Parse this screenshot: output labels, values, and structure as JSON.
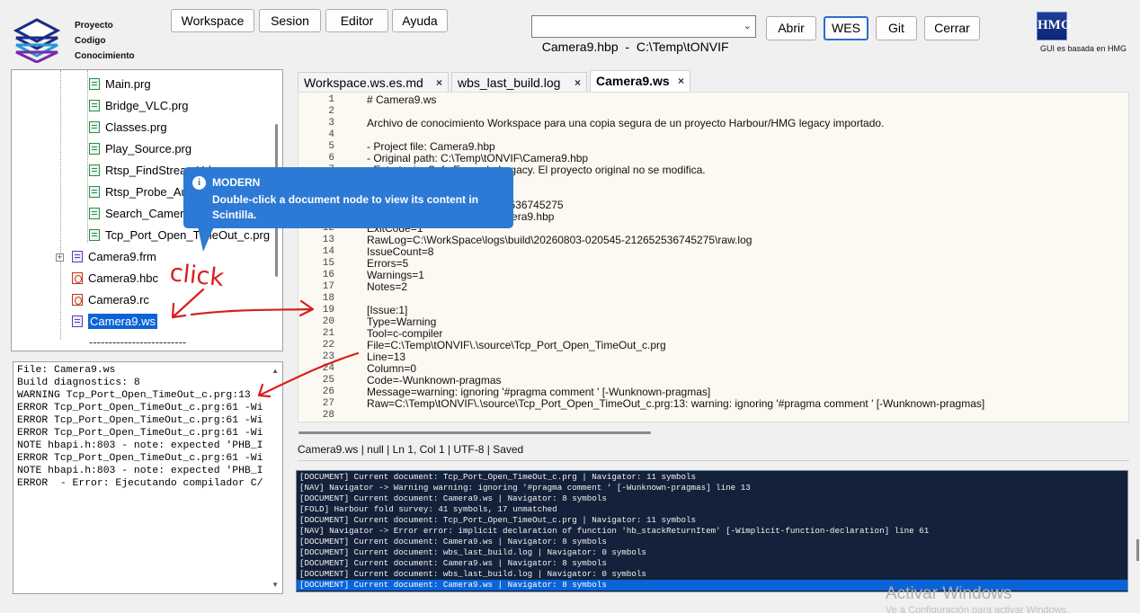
{
  "logo_text": [
    "Proyecto",
    "Codigo",
    "Conocimiento"
  ],
  "menu": [
    "Workspace",
    "Sesion",
    "Editor",
    "Ayuda"
  ],
  "project_select": {
    "value": "Camera9.hbp  -  C:\\Temp\\tONVIF"
  },
  "actions": [
    "Abrir",
    "WES",
    "Git",
    "Cerrar"
  ],
  "hmg": {
    "logo": "HMG",
    "text": "GUI es basada en HMG"
  },
  "tree": {
    "items": [
      {
        "label": "Main.prg",
        "icon": "prg-file-icon"
      },
      {
        "label": "Bridge_VLC.prg",
        "icon": "prg-file-icon"
      },
      {
        "label": "Classes.prg",
        "icon": "prg-file-icon"
      },
      {
        "label": "Play_Source.prg",
        "icon": "prg-file-icon"
      },
      {
        "label": "Rtsp_FindStreamUrl.prg",
        "icon": "prg-file-icon"
      },
      {
        "label": "Rtsp_Probe_Auth.prg",
        "icon": "prg-file-icon"
      },
      {
        "label": "Search_Camera.prg",
        "icon": "prg-file-icon"
      },
      {
        "label": "Tcp_Port_Open_TimeOut_c.prg",
        "icon": "prg-file-icon"
      },
      {
        "label": "Camera9.frm",
        "icon": "form-file-icon"
      },
      {
        "label": "Camera9.hbc",
        "icon": "resource-file-icon"
      },
      {
        "label": "Camera9.rc",
        "icon": "resource-file-icon"
      },
      {
        "label": "Camera9.ws",
        "icon": "workspace-file-icon"
      }
    ],
    "separator": "-------------------------"
  },
  "diagnostics": [
    "File: Camera9.ws",
    "Build diagnostics: 8",
    "WARNING Tcp_Port_Open_TimeOut_c.prg:13",
    "ERROR Tcp_Port_Open_TimeOut_c.prg:61 -Wi",
    "ERROR Tcp_Port_Open_TimeOut_c.prg:61 -Wi",
    "ERROR Tcp_Port_Open_TimeOut_c.prg:61 -Wi",
    "NOTE hbapi.h:803 - note: expected 'PHB_I",
    "ERROR Tcp_Port_Open_TimeOut_c.prg:61 -Wi",
    "NOTE hbapi.h:803 - note: expected 'PHB_I",
    "ERROR  - Error: Ejecutando compilador C/"
  ],
  "tabs": [
    {
      "label": "Workspace.ws.es.md",
      "close": "×"
    },
    {
      "label": "wbs_last_build.log",
      "close": "×"
    },
    {
      "label": "Camera9.ws",
      "close": "×"
    }
  ],
  "editor_lines": [
    {
      "n": "1",
      "t": "# Camera9.ws"
    },
    {
      "n": "2",
      "t": ""
    },
    {
      "n": "3",
      "t": "Archivo de conocimiento Workspace para una copia segura de un proyecto Harbour/HMG legacy importado."
    },
    {
      "n": "4",
      "t": ""
    },
    {
      "n": "5",
      "t": "- Project file: Camera9.hbp"
    },
    {
      "n": "6",
      "t": "- Original path: C:\\Temp\\tONVIF\\Camera9.hbp"
    },
    {
      "n": "7",
      "t": "- Estrategia: Safe Example Legacy. El proyecto original no se modifica."
    },
    {
      "n": "8",
      "t": ""
    },
    {
      "n": "9",
      "t": ""
    },
    {
      "n": "10",
      "t": "Id=20260803-020545-212652536745275"
    },
    {
      "n": "11",
      "t": "Project=C:\\Temp\\tONVIF\\Camera9.hbp"
    },
    {
      "n": "12",
      "t": "ExitCode=1"
    },
    {
      "n": "13",
      "t": "RawLog=C:\\WorkSpace\\logs\\build\\20260803-020545-212652536745275\\raw.log"
    },
    {
      "n": "14",
      "t": "IssueCount=8"
    },
    {
      "n": "15",
      "t": "Errors=5"
    },
    {
      "n": "16",
      "t": "Warnings=1"
    },
    {
      "n": "17",
      "t": "Notes=2"
    },
    {
      "n": "18",
      "t": ""
    },
    {
      "n": "19",
      "t": "[Issue:1]"
    },
    {
      "n": "20",
      "t": "Type=Warning"
    },
    {
      "n": "21",
      "t": "Tool=c-compiler"
    },
    {
      "n": "22",
      "t": "File=C:\\Temp\\tONVIF\\.\\source\\Tcp_Port_Open_TimeOut_c.prg"
    },
    {
      "n": "23",
      "t": "Line=13"
    },
    {
      "n": "24",
      "t": "Column=0"
    },
    {
      "n": "25",
      "t": "Code=-Wunknown-pragmas"
    },
    {
      "n": "26",
      "t": "Message=warning: ignoring '#pragma comment ' [-Wunknown-pragmas]"
    },
    {
      "n": "27",
      "t": "Raw=C:\\Temp\\tONVIF\\.\\source\\Tcp_Port_Open_TimeOut_c.prg:13: warning: ignoring '#pragma comment ' [-Wunknown-pragmas]"
    },
    {
      "n": "28",
      "t": ""
    },
    {
      "n": "29",
      "t": "[Issue:2]"
    }
  ],
  "status": "Camera9.ws | null | Ln 1, Col 1 | UTF-8 | Saved",
  "log_lines": [
    "[DOCUMENT] Current document: Tcp_Port_Open_TimeOut_c.prg | Navigator: 11 symbols",
    "[NAV] Navigator -> Warning warning: ignoring '#pragma comment ' [-Wunknown-pragmas] line 13",
    "[DOCUMENT] Current document: Camera9.ws | Navigator: 8 symbols",
    "[FOLD] Harbour fold survey: 41 symbols, 17 unmatched",
    "[DOCUMENT] Current document: Tcp_Port_Open_TimeOut_c.prg | Navigator: 11 symbols",
    "[NAV] Navigator -> Error error: implicit declaration of function 'hb_stackReturnItem' [-Wimplicit-function-declaration] line 61",
    "[DOCUMENT] Current document: Camera9.ws | Navigator: 8 symbols",
    "[DOCUMENT] Current document: wbs_last_build.log | Navigator: 0 symbols",
    "[DOCUMENT] Current document: Camera9.ws | Navigator: 8 symbols",
    "[DOCUMENT] Current document: wbs_last_build.log | Navigator: 0 symbols",
    "[DOCUMENT] Current document: Camera9.ws | Navigator: 8 symbols"
  ],
  "callout": {
    "title": "MODERN",
    "message": "Double-click a document node to view its content in Scintilla.",
    "icon": "info-icon"
  },
  "annotation": {
    "text": "click",
    "color": "#d81e1e"
  },
  "watermark": {
    "title": "Activar Windows",
    "subtitle": "Ve a Configuración para activar Windows."
  },
  "colors": {
    "selection": "#0a64d8",
    "callout": "#2c79d6",
    "log_bg": "#13223a",
    "editor_bg": "#fbf9f1"
  }
}
